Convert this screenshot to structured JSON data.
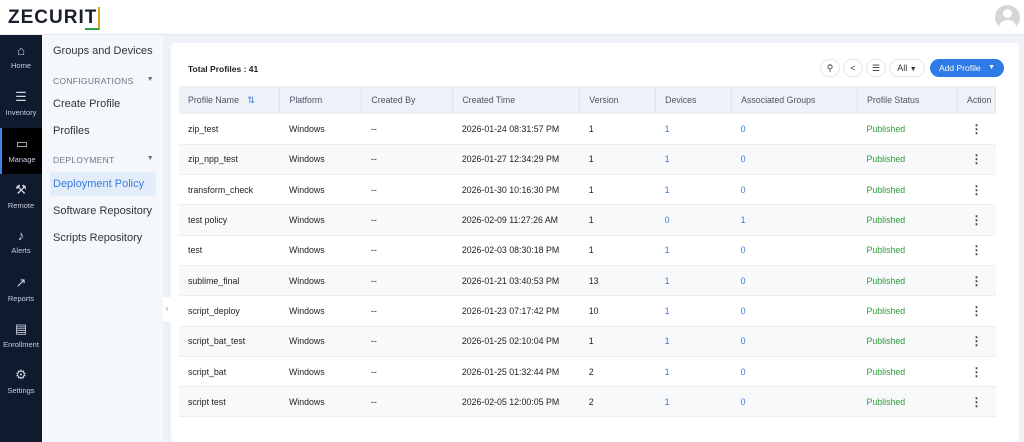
{
  "brand": {
    "logo": "ZECURIT"
  },
  "rail": [
    {
      "label": "Home",
      "icon": "home-icon",
      "glyph": "⌂"
    },
    {
      "label": "Inventory",
      "icon": "list-icon",
      "glyph": "☰"
    },
    {
      "label": "Manage",
      "icon": "monitor-icon",
      "glyph": "▭"
    },
    {
      "label": "Remote",
      "icon": "tools-icon",
      "glyph": "⚒"
    },
    {
      "label": "Alerts",
      "icon": "bell-icon",
      "glyph": "♪"
    },
    {
      "label": "Reports",
      "icon": "chart-icon",
      "glyph": "↗"
    },
    {
      "label": "Enrollment",
      "icon": "document-icon",
      "glyph": "▤"
    },
    {
      "label": "Settings",
      "icon": "gear-icon",
      "glyph": "⚙"
    }
  ],
  "submenu": {
    "groups_devices": "Groups and Devices",
    "configurations": "CONFIGURATIONS",
    "create_profile": "Create Profile",
    "profiles": "Profiles",
    "deployment": "DEPLOYMENT",
    "deployment_policy": "Deployment Policy",
    "software_repository": "Software Repository",
    "scripts_repository": "Scripts Repository"
  },
  "toolbar": {
    "total": "Total Profiles : 41",
    "filter": "All",
    "add": "Add Profile"
  },
  "columns": [
    "Profile Name",
    "Platform",
    "Created By",
    "Created Time",
    "Version",
    "Devices",
    "Associated Groups",
    "Profile Status",
    "Action"
  ],
  "rows": [
    [
      "zip_test",
      "Windows",
      "--",
      "2026-01-24 08:31:57 PM",
      "1",
      "1",
      "0",
      "Published"
    ],
    [
      "zip_npp_test",
      "Windows",
      "--",
      "2026-01-27 12:34:29 PM",
      "1",
      "1",
      "0",
      "Published"
    ],
    [
      "transform_check",
      "Windows",
      "--",
      "2026-01-30 10:16:30 PM",
      "1",
      "1",
      "0",
      "Published"
    ],
    [
      "test policy",
      "Windows",
      "--",
      "2026-02-09 11:27:26 AM",
      "1",
      "0",
      "1",
      "Published"
    ],
    [
      "test",
      "Windows",
      "--",
      "2026-02-03 08:30:18 PM",
      "1",
      "1",
      "0",
      "Published"
    ],
    [
      "sublime_final",
      "Windows",
      "--",
      "2026-01-21 03:40:53 PM",
      "13",
      "1",
      "0",
      "Published"
    ],
    [
      "script_deploy",
      "Windows",
      "--",
      "2026-01-23 07:17:42 PM",
      "10",
      "1",
      "0",
      "Published"
    ],
    [
      "script_bat_test",
      "Windows",
      "--",
      "2026-01-25 02:10:04 PM",
      "1",
      "1",
      "0",
      "Published"
    ],
    [
      "script_bat",
      "Windows",
      "--",
      "2026-01-25 01:32:44 PM",
      "2",
      "1",
      "0",
      "Published"
    ],
    [
      "script test",
      "Windows",
      "--",
      "2026-02-05 12:00:05 PM",
      "2",
      "1",
      "0",
      "Published"
    ]
  ]
}
